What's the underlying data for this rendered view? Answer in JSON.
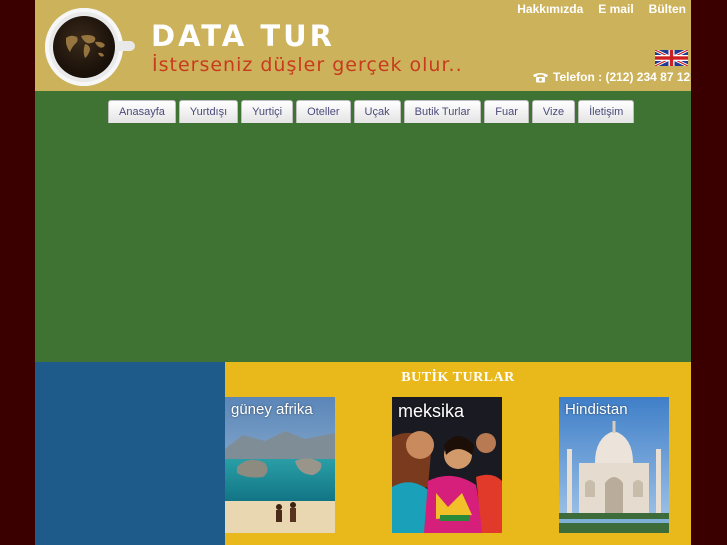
{
  "header": {
    "brand": "DATA TUR",
    "slogan": "İsterseniz düşler gerçek olur..",
    "top_links": [
      "Hakkımızda",
      "E mail",
      "Bülten"
    ],
    "phone": "Telefon : (212) 234 87 12"
  },
  "nav": {
    "tabs": [
      "Anasayfa",
      "Yurtdışı",
      "Yurtiçi",
      "Oteller",
      "Uçak",
      "Butik Turlar",
      "Fuar",
      "Vize",
      "İletişim"
    ]
  },
  "butik": {
    "title": "BUTİK TURLAR",
    "tours": [
      {
        "label": "güney afrika"
      },
      {
        "label": "meksika"
      },
      {
        "label": "Hindistan"
      }
    ]
  },
  "colors": {
    "outer_background": "#3a0000",
    "header_background": "#ccb25a",
    "content_background": "#3f7333",
    "left_panel": "#1e5b8a",
    "butik_background": "#e9b91c",
    "slogan": "#c83a1e"
  }
}
